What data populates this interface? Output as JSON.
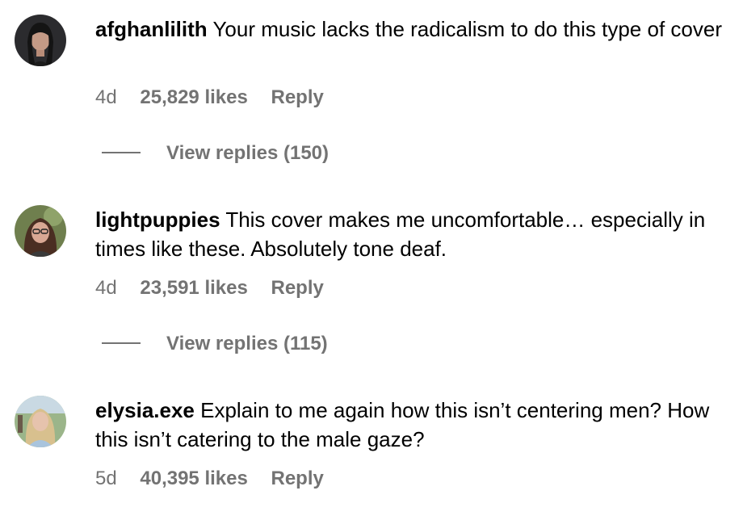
{
  "comments": [
    {
      "username": "afghanlilith",
      "text": "Your music lacks the radicalism to do this type of cover",
      "age": "4d",
      "likes": "25,829 likes",
      "reply": "Reply",
      "view_replies": "View replies (150)"
    },
    {
      "username": "lightpuppies",
      "text": "This cover makes me uncomfortable… especially in times like these. Absolutely tone deaf.",
      "age": "4d",
      "likes": "23,591 likes",
      "reply": "Reply",
      "view_replies": "View replies (115)"
    },
    {
      "username": "elysia.exe",
      "text": "Explain to me again how this isn’t centering men? How this isn’t catering to the male gaze?",
      "age": "5d",
      "likes": "40,395 likes",
      "reply": "Reply"
    }
  ]
}
